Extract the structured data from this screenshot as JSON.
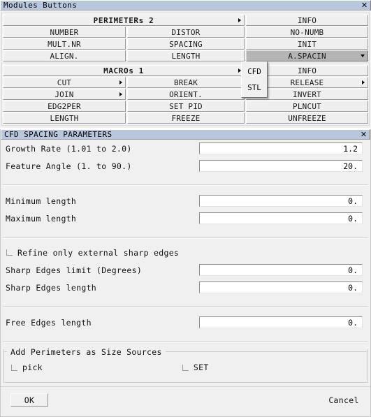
{
  "modules_window": {
    "title": "Modules Buttons",
    "close_icon": "✕",
    "perimeters": {
      "header": "PERIMETERs 2",
      "header_arrow": "submenu-arrow",
      "rows": [
        {
          "col1": "PERIMETERs 2",
          "col1_span": true,
          "col3": "INFO"
        },
        {
          "col1": "NUMBER",
          "col2": "DISTOR",
          "col3": "NO-NUMB"
        },
        {
          "col1": "MULT.NR",
          "col2": "SPACING",
          "col3": "INIT"
        },
        {
          "col1": "ALIGN.",
          "col2": "LENGTH",
          "col3": "A.SPACIN"
        }
      ]
    },
    "macros": {
      "header": "MACROs 1",
      "rows": [
        {
          "col1": "MACROs 1",
          "col1_span": true,
          "col3": "INFO"
        },
        {
          "col1": "CUT",
          "col2": "BREAK",
          "col3": "RELEASE"
        },
        {
          "col1": "JOIN",
          "col2": "ORIENT.",
          "col3": "INVERT"
        },
        {
          "col1": "EDG2PER",
          "col2": "SET PID",
          "col3": "PLNCUT"
        },
        {
          "col1": "LENGTH",
          "col2": "FREEZE",
          "col3": "UNFREEZE"
        }
      ]
    },
    "popup": {
      "items": [
        "CFD",
        "STL"
      ]
    }
  },
  "cfd_dialog": {
    "title": "CFD SPACING PARAMETERS",
    "close_icon": "✕",
    "fields": [
      {
        "label": "Growth Rate   (1.01 to 2.0)",
        "value": "1.2"
      },
      {
        "label": "Feature Angle (1. to 90.)",
        "value": "20."
      },
      {
        "label": "Minimum length",
        "value": "0."
      },
      {
        "label": "Maximum length",
        "value": "0."
      },
      {
        "label": "Sharp Edges limit (Degrees)",
        "value": "0."
      },
      {
        "label": "Sharp Edges length",
        "value": "0."
      },
      {
        "label": "Free Edges length",
        "value": "0."
      }
    ],
    "refine_checkbox": {
      "label": "Refine only external sharp edges",
      "checked": false
    },
    "size_sources_group": {
      "title": "Add Perimeters as Size Sources",
      "pick_label": "pick",
      "set_label": "SET"
    },
    "ok_label": "OK",
    "cancel_label": "Cancel"
  },
  "colors": {
    "titlebar": "#b9c7de",
    "window_bg": "#f0f0f0",
    "button_face": "#efefef",
    "active_button": "#b5b5b5",
    "field_bg": "#ffffff",
    "text": "#000000"
  }
}
